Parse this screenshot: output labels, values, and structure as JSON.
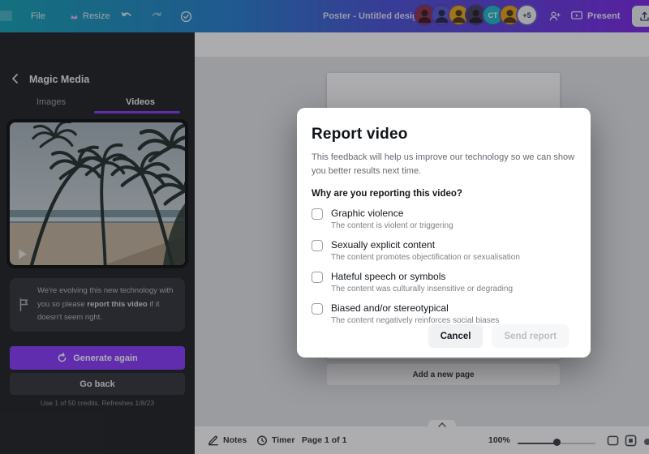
{
  "topbar": {
    "file_label": "File",
    "resize_label": "Resize",
    "doc_title": "Poster - Untitled design",
    "present_label": "Present",
    "avatars": [
      {
        "bg": "#93354a",
        "type": "person"
      },
      {
        "bg": "#5a5fd6",
        "type": "person"
      },
      {
        "bg": "#e9ae1d",
        "type": "person"
      },
      {
        "bg": "#46405e",
        "type": "person"
      },
      {
        "bg": "#22bccb",
        "type": "text",
        "label": "CT",
        "fg": "#ffffff"
      },
      {
        "bg": "#e9a51f",
        "type": "person"
      },
      {
        "bg": "#f2f3f5",
        "type": "text",
        "label": "+5",
        "fg": "#40454c"
      }
    ]
  },
  "sidebar": {
    "title": "Magic Media",
    "tabs": {
      "images": "Images",
      "videos": "Videos"
    },
    "notice": {
      "pre": "We're evolving this new technology with you so please ",
      "bold": "report this video",
      "post": " if it doesn't seem right."
    },
    "generate_label": "Generate again",
    "goback_label": "Go back",
    "credits": "Use 1 of 50 credits. Refreshes 1/8/23"
  },
  "canvas": {
    "add_page_label": "Add a new page"
  },
  "bottombar": {
    "notes_label": "Notes",
    "timer_label": "Timer",
    "page_indicator": "Page 1 of 1",
    "zoom_level": "100%"
  },
  "modal": {
    "title": "Report video",
    "description": "This feedback will help us improve our technology so we can show you better results next time.",
    "question": "Why are you reporting this video?",
    "options": [
      {
        "label": "Graphic violence",
        "description": "The content is violent or triggering",
        "checked": false
      },
      {
        "label": "Sexually explicit content",
        "description": "The content promotes objectification or sexualisation",
        "checked": false
      },
      {
        "label": "Hateful speech or symbols",
        "description": "The content was culturally insensitive or degrading",
        "checked": false
      },
      {
        "label": "Biased and/or stereotypical",
        "description": "The content negatively reinforces social biases",
        "checked": false
      }
    ],
    "cancel_label": "Cancel",
    "send_label": "Send report"
  },
  "colors": {
    "accent_purple": "#8b3dff",
    "topbar_teal": "#17a3b5",
    "topbar_purple": "#7d2ae8",
    "sidebar_bg": "#232528",
    "modal_bg": "#ffffff"
  }
}
